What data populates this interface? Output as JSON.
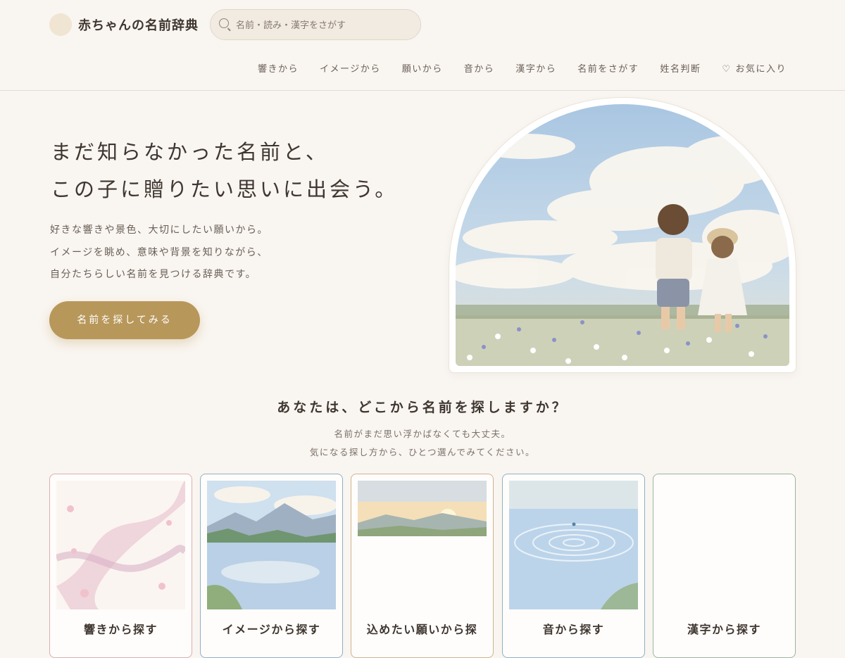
{
  "header": {
    "site_title": "赤ちゃんの名前辞典",
    "search_placeholder": "名前・読み・漢字をさがす",
    "nav": [
      "響きから",
      "イメージから",
      "願いから",
      "音から",
      "漢字から",
      "名前をさがす",
      "姓名判断"
    ],
    "favorites_label": "お気に入り",
    "favorites_icon": "heart-icon"
  },
  "hero": {
    "title_lines": [
      "まだ知らなかった名前と、",
      "この子に贈りたい思いに出会う。"
    ],
    "description_lines": [
      "好きな響きや景色、大切にしたい願いから。",
      "イメージを眺め、意味や背景を知りながら、",
      "自分たちらしい名前を見つける辞典です。"
    ],
    "cta_label": "名前を探してみる"
  },
  "section": {
    "title": "あなたは、どこから名前を探しますか？",
    "subtitle_lines": [
      "名前がまだ思い浮かばなくても大丈夫。",
      "気になる探し方から、ひとつ選んでみてください。"
    ]
  },
  "cards": [
    {
      "label": "響きから探す",
      "border": "#dcb0ac"
    },
    {
      "label": "イメージから探す",
      "border": "#8fb0c6"
    },
    {
      "label": "込めたい願いから探",
      "border": "#d0b38d"
    },
    {
      "label": "音から探す",
      "border": "#8fb0c6"
    },
    {
      "label": "漢字から探す",
      "border": "#9cb59a"
    }
  ],
  "colors": {
    "background": "#f9f5f0",
    "accent": "#b8975a",
    "text": "#3f3630"
  }
}
